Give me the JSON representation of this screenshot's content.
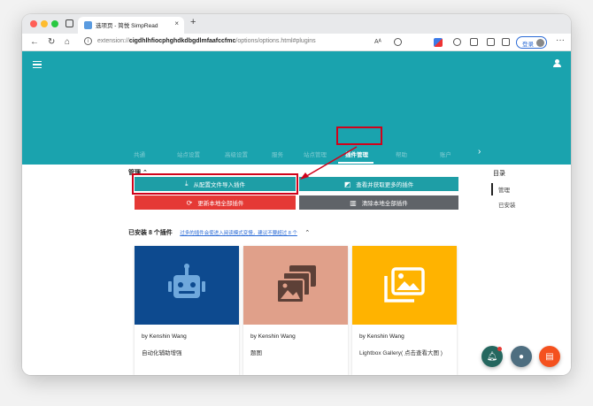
{
  "browser": {
    "tab_title": "选项页 - 简悦 SimpRead",
    "url_prefix": "extension://",
    "url_host": "cigdhlhfiocphghdkdbgdlmfaafccfmc",
    "url_path": "/options/options.html#plugins",
    "login_label": "登录"
  },
  "nav": {
    "tabs": [
      "共通",
      "站点设置",
      "高级设置",
      "服务",
      "站点管理",
      "插件管理",
      "帮助",
      "账户"
    ],
    "active_index": 5
  },
  "manage": {
    "title": "管理",
    "import_label": "从配置文件导入插件",
    "more_label": "查看并获取更多的插件",
    "update_label": "更新本地全部插件",
    "clear_label": "清除本地全部插件"
  },
  "installed": {
    "title": "已安装 8 个插件",
    "note": "过多的插件会使进入阅读模式变慢，建议不要超过 8 个"
  },
  "cards": [
    {
      "author": "by Kenshin Wang",
      "desc": "自动化辅助增强",
      "color": "#0d4a8f",
      "icon": "robot-icon"
    },
    {
      "author": "by Kenshin Wang",
      "desc": "题图",
      "color": "#e0a08a",
      "icon": "images-icon"
    },
    {
      "author": "by Kenshin Wang",
      "desc": "Lightbox Gallery( 点击查看大图 )",
      "color": "#ffb300",
      "icon": "gallery-icon"
    }
  ],
  "toc": {
    "title": "目录",
    "items": [
      "管理",
      "已安装"
    ]
  }
}
